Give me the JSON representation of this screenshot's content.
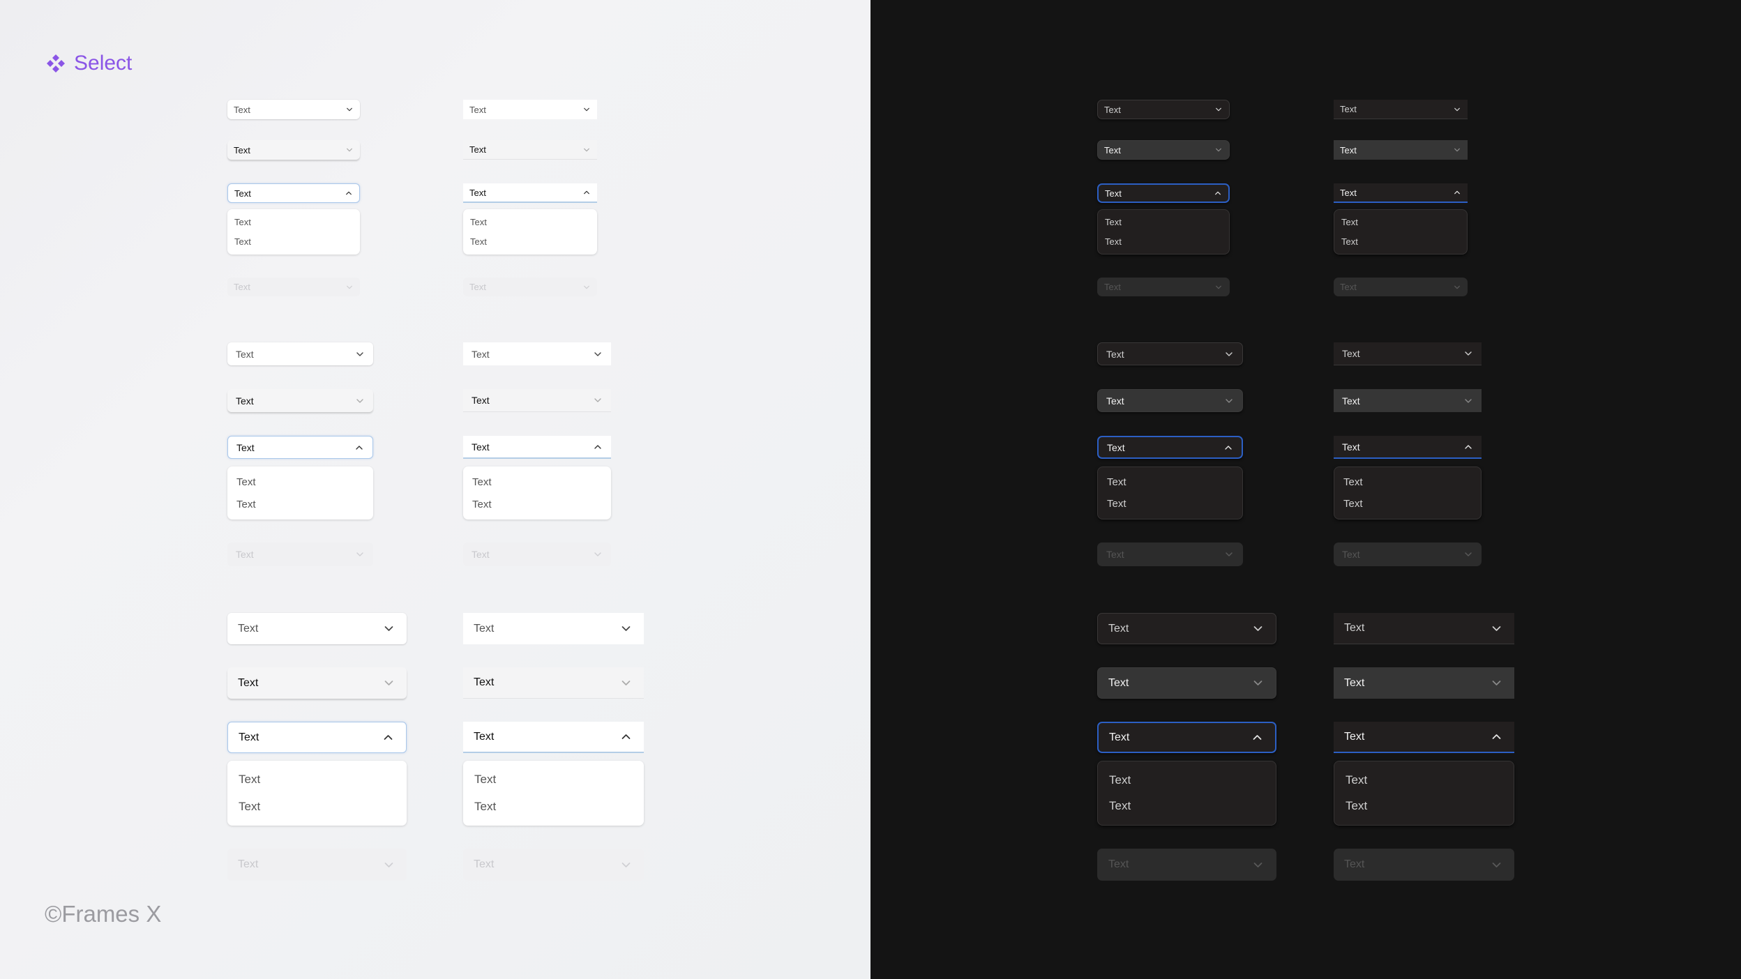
{
  "header": {
    "title": "Select",
    "icon": "component-icon"
  },
  "footer": {
    "copyright": "©Frames X"
  },
  "themes": {
    "light": {
      "background": "#f1f2f4",
      "accent": "#8a55e6",
      "focus_border": "#a9c7ea"
    },
    "dark": {
      "background": "#141414",
      "focus_border": "#2c5fc4"
    }
  },
  "select": {
    "value": "Text",
    "options": [
      "Text",
      "Text"
    ],
    "sizes": [
      "small",
      "medium",
      "large"
    ],
    "variants": [
      "outlined",
      "filled"
    ],
    "states": [
      "default",
      "hover",
      "focus-open",
      "disabled"
    ]
  }
}
